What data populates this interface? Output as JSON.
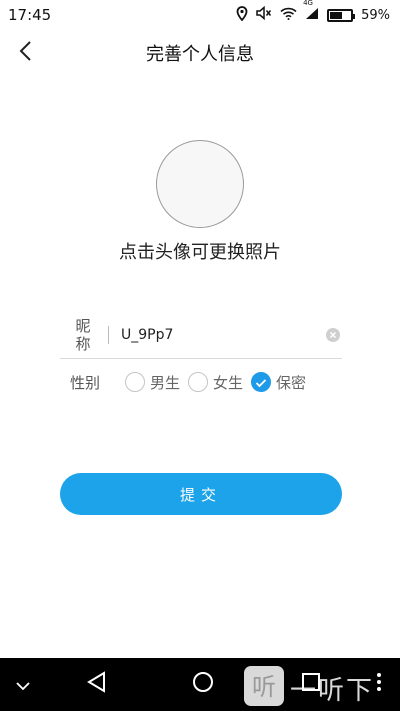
{
  "status_bar": {
    "time": "17:45",
    "network": "4G",
    "battery_percent": "59%",
    "battery_level": 0.59,
    "icons": [
      "location-icon",
      "mute-icon",
      "wifi-icon",
      "signal-icon",
      "battery-icon"
    ]
  },
  "header": {
    "title": "完善个人信息",
    "back_icon": "back-arrow-icon"
  },
  "avatar": {
    "hint": "点击头像可更换照片"
  },
  "form": {
    "nickname_label_line1": "昵",
    "nickname_label_line2": "称",
    "nickname_value": "U_9Pp7",
    "gender_label": "性别",
    "gender_options": [
      {
        "label": "男生",
        "checked": false
      },
      {
        "label": "女生",
        "checked": false
      },
      {
        "label": "保密",
        "checked": true
      }
    ],
    "submit_label": "提交"
  },
  "colors": {
    "accent": "#1ca3ea",
    "checked": "#1e9be8"
  },
  "nav_bar": {
    "icons": [
      "collapse-icon",
      "back-triangle-icon",
      "home-circle-icon",
      "recents-square-icon",
      "more-icon"
    ]
  },
  "watermark": {
    "text": "一听下载"
  }
}
